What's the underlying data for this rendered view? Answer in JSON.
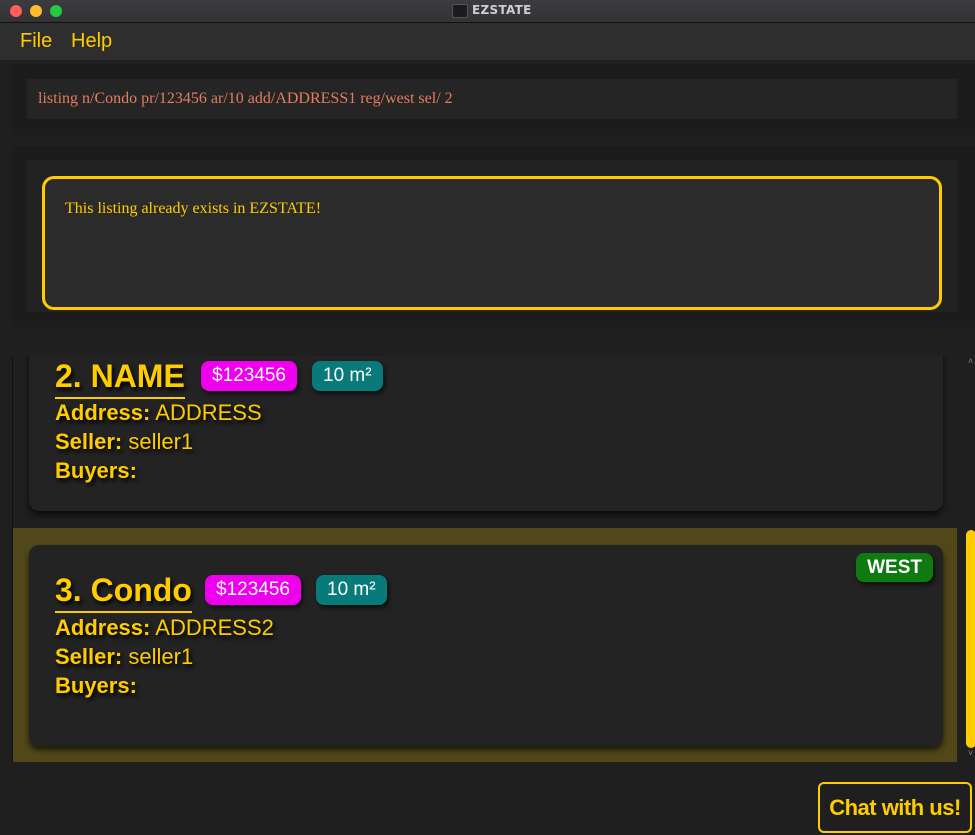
{
  "window": {
    "title": "EZSTATE"
  },
  "menu": {
    "file": "File",
    "help": "Help"
  },
  "command_box": {
    "value": "listing n/Condo pr/123456 ar/10 add/ADDRESS1 reg/west sel/ 2"
  },
  "result_display": {
    "message": "This listing already exists in EZSTATE!"
  },
  "listings": [
    {
      "index_name": "2. NAME",
      "price": "$123456",
      "area": "10 m²",
      "address_label": "Address:",
      "address": "ADDRESS",
      "seller_label": "Seller:",
      "seller": "seller1",
      "buyers_label": "Buyers:",
      "buyers": ""
    },
    {
      "index_name": "3. Condo",
      "price": "$123456",
      "area": "10 m²",
      "region": "WEST",
      "address_label": "Address:",
      "address": "ADDRESS2",
      "seller_label": "Seller:",
      "seller": "seller1",
      "buyers_label": "Buyers:",
      "buyers": "",
      "selected": true
    }
  ],
  "chat_button": {
    "label": "Chat with us!"
  },
  "scrollbar": {
    "up_arrow": "˄",
    "down_arrow": "˅"
  },
  "colors": {
    "accent": "#ffcc00",
    "price_tag": "#ee00ee",
    "area_tag": "#087a7a",
    "region_tag": "#0f7a0f",
    "command_text": "#e57c5b",
    "selected_row": "#524718"
  }
}
